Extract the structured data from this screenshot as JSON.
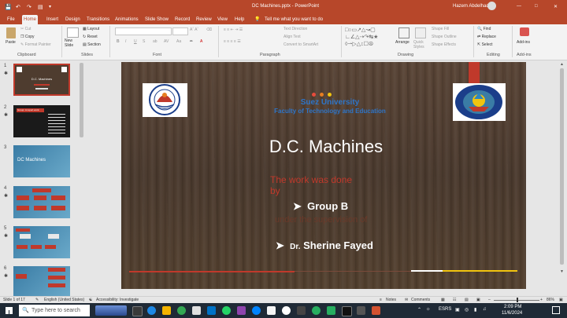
{
  "window": {
    "title": "DC Machines.pptx  -  PowerPoint",
    "user": "Hazem Abdelhady"
  },
  "tabs": [
    "File",
    "Home",
    "Insert",
    "Design",
    "Transitions",
    "Animations",
    "Slide Show",
    "Record",
    "Review",
    "View",
    "Help"
  ],
  "tell_me": "Tell me what you want to do",
  "ribbon": {
    "clipboard": {
      "paste": "Paste",
      "cut": "Cut",
      "copy": "Copy",
      "format_painter": "Format Painter",
      "label": "Clipboard"
    },
    "slides": {
      "new_slide": "New Slide",
      "layout": "Layout",
      "reset": "Reset",
      "section": "Section",
      "label": "Slides"
    },
    "font": {
      "label": "Font",
      "bold": "B",
      "italic": "I",
      "underline": "U",
      "strike": "S",
      "aa": "A"
    },
    "paragraph": {
      "label": "Paragraph",
      "text_direction": "Text Direction",
      "align_text": "Align Text",
      "smartart": "Convert to SmartArt"
    },
    "drawing": {
      "label": "Drawing",
      "arrange": "Arrange",
      "quick_styles": "Quick Styles",
      "shape_fill": "Shape Fill",
      "shape_outline": "Shape Outline",
      "shape_effects": "Shape Effects"
    },
    "editing": {
      "label": "Editing",
      "find": "Find",
      "replace": "Replace",
      "select": "Select"
    },
    "addins": {
      "button": "Add-ins",
      "label": "Add-ins"
    }
  },
  "thumbnails": [
    {
      "num": "1",
      "text": "D.C. Machines"
    },
    {
      "num": "2",
      "text": "Group: A report work"
    },
    {
      "num": "3",
      "text": "DC Machines"
    },
    {
      "num": "4",
      "text": ""
    },
    {
      "num": "5",
      "text": ""
    },
    {
      "num": "6",
      "text": ""
    }
  ],
  "slide": {
    "university": "Suez University",
    "faculty": "Faculty of Technology and Education",
    "title": "D.C. Machines",
    "work_line1": "The work was done",
    "work_line2": "by",
    "group": "Group B",
    "supervision": "under the supervision of",
    "dr_prefix": "Dr.",
    "dr_name": "Sherine Fayed"
  },
  "status": {
    "slide_of": "Slide 1 of 17",
    "language": "English (United States)",
    "accessibility": "Accessibility: Investigate",
    "notes": "Notes",
    "comments": "Comments",
    "zoom": "86%"
  },
  "taskbar": {
    "search_placeholder": "Type here to search",
    "lang": "ESRS",
    "time": "2:09 PM",
    "date": "11/6/2024"
  },
  "colors": {
    "accent": "#b7472a",
    "university_blue": "#2e75c8",
    "work_red": "#c0392b",
    "title_white": "#ffffff"
  }
}
